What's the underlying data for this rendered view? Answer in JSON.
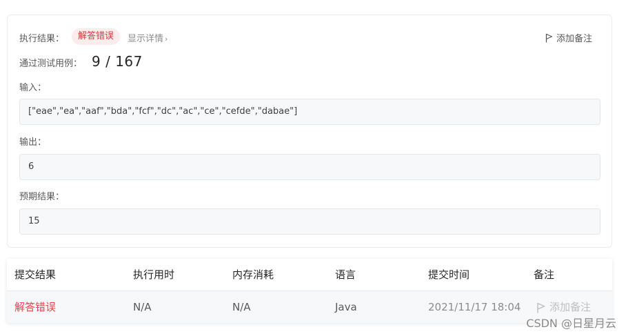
{
  "result": {
    "label": "执行结果：",
    "status": "解答错误",
    "detail_link": "显示详情",
    "detail_chevron": "›",
    "add_note": "添加备注"
  },
  "passed": {
    "label": "通过测试用例：",
    "count": "9 / 167"
  },
  "input": {
    "label": "输入：",
    "value": "[\"eae\",\"ea\",\"aaf\",\"bda\",\"fcf\",\"dc\",\"ac\",\"ce\",\"cefde\",\"dabae\"]"
  },
  "output": {
    "label": "输出：",
    "value": "6"
  },
  "expected": {
    "label": "预期结果：",
    "value": "15"
  },
  "table": {
    "headers": [
      "提交结果",
      "执行用时",
      "内存消耗",
      "语言",
      "提交时间",
      "备注"
    ],
    "rows": [
      {
        "status": "解答错误",
        "runtime": "N/A",
        "memory": "N/A",
        "language": "Java",
        "time": "2021/11/17 18:04",
        "note": "添加备注"
      }
    ]
  },
  "watermark": "CSDN @日星月云",
  "colors": {
    "error": "#e5454a",
    "badge_bg": "#fdecec",
    "field_bg": "#f7f8fa"
  },
  "icons": {
    "flag": "flag-icon"
  }
}
